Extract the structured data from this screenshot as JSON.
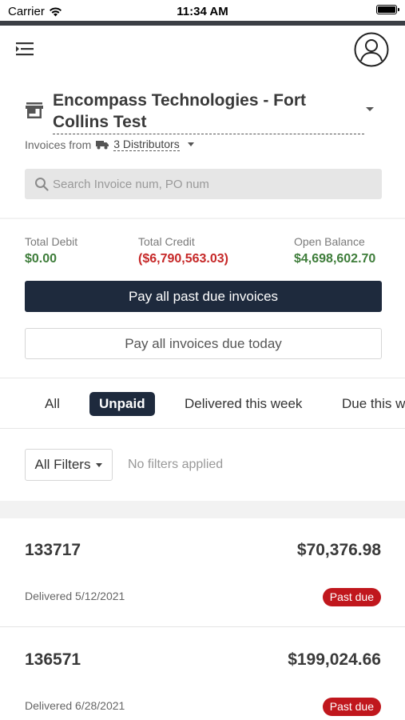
{
  "status_bar": {
    "carrier": "Carrier",
    "time": "11:34 AM"
  },
  "header": {
    "company_name": "Encompass Technologies - Fort Collins Test",
    "invoices_from_label": "Invoices from",
    "distributors_label": "3 Distributors",
    "search_placeholder": "Search Invoice num, PO num"
  },
  "totals": {
    "debit_label": "Total Debit",
    "debit_value": "$0.00",
    "credit_label": "Total Credit",
    "credit_value": "($6,790,563.03)",
    "balance_label": "Open Balance",
    "balance_value": "$4,698,602.70",
    "pay_past_due_label": "Pay all past due invoices",
    "pay_due_today_label": "Pay all invoices due today"
  },
  "tabs": [
    {
      "label": "All",
      "active": false
    },
    {
      "label": "Unpaid",
      "active": true
    },
    {
      "label": "Delivered this week",
      "active": false
    },
    {
      "label": "Due this w",
      "active": false
    }
  ],
  "filters": {
    "button_label": "All Filters",
    "status_text": "No filters applied"
  },
  "invoices": [
    {
      "number": "133717",
      "amount": "$70,376.98",
      "delivered": "Delivered 5/12/2021",
      "status": "Past due"
    },
    {
      "number": "136571",
      "amount": "$199,024.66",
      "delivered": "Delivered 6/28/2021",
      "status": "Past due"
    }
  ],
  "colors": {
    "primary_dark": "#1e2a3d",
    "positive": "#3e7d3a",
    "negative": "#c62828",
    "past_due_badge": "#c0171d"
  },
  "icons": [
    "wifi-icon",
    "battery-icon",
    "menu-icon",
    "user-avatar-icon",
    "store-icon",
    "truck-icon",
    "search-icon",
    "chevron-down-icon"
  ]
}
